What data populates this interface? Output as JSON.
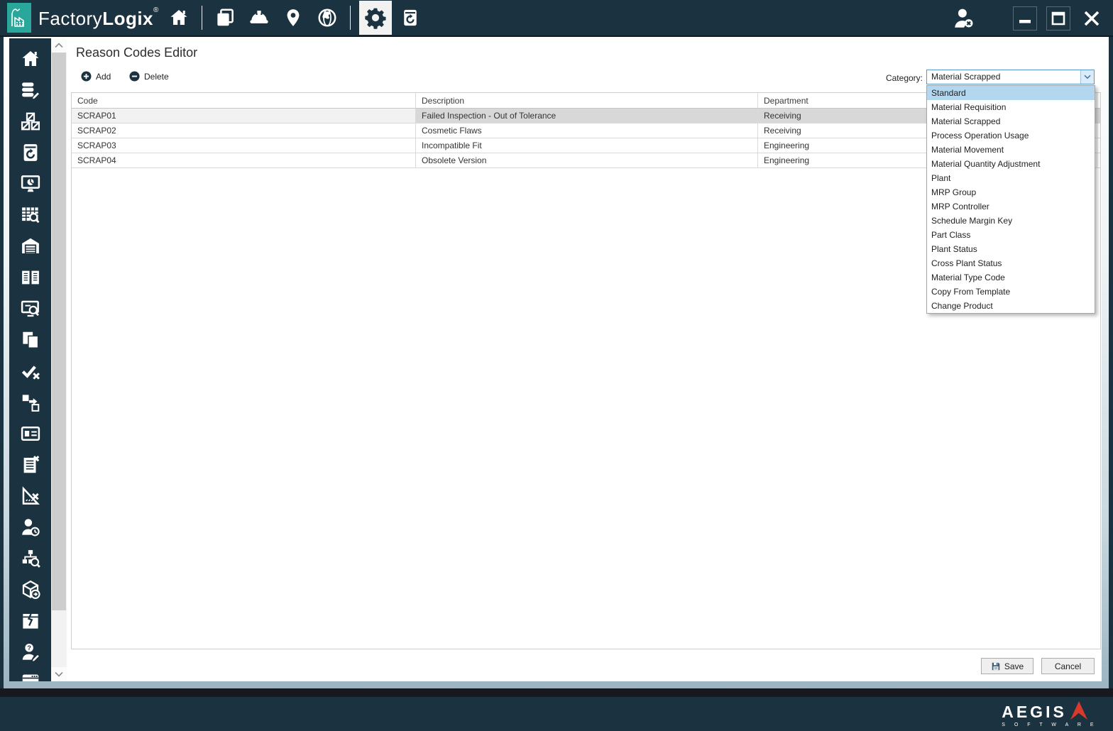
{
  "titlebar": {
    "brand": {
      "part1": "Factory",
      "part2": "Logix",
      "mark": "®"
    },
    "nav_icons": [
      "home",
      "pages",
      "hardhat",
      "location-pin",
      "globe",
      "settings-gear",
      "restore-backup"
    ],
    "active_icon": "settings-gear",
    "window_controls": [
      "user-signout",
      "minimize",
      "maximize",
      "close"
    ]
  },
  "sidebar": {
    "items": [
      "home",
      "data-editor",
      "materials",
      "backup",
      "dashboard",
      "data-grid-search",
      "warehouse",
      "documentation",
      "monitor-search",
      "documents",
      "approve-reject",
      "transfer",
      "id-card",
      "list-delete",
      "measure-delete",
      "user-time",
      "org-search",
      "package-export",
      "damaged-package",
      "user-query",
      "terminal"
    ]
  },
  "editor": {
    "title": "Reason Codes Editor",
    "toolbar": {
      "add_label": "Add",
      "delete_label": "Delete"
    },
    "category": {
      "label": "Category:",
      "value": "Material Scrapped",
      "highlighted_index": 0,
      "options": [
        "Standard",
        "Material Requisition",
        "Material Scrapped",
        "Process Operation Usage",
        "Material Movement",
        "Material Quantity Adjustment",
        "Plant",
        "MRP Group",
        "MRP Controller",
        "Schedule Margin Key",
        "Part Class",
        "Plant Status",
        "Cross Plant Status",
        "Material Type Code",
        "Copy From Template",
        "Change Product"
      ]
    },
    "table": {
      "columns": [
        "Code",
        "Description",
        "Department"
      ],
      "rows": [
        {
          "code": "SCRAP01",
          "description": "Failed Inspection - Out of Tolerance",
          "department": "Receiving",
          "selected": true
        },
        {
          "code": "SCRAP02",
          "description": "Cosmetic Flaws",
          "department": "Receiving",
          "selected": false
        },
        {
          "code": "SCRAP03",
          "description": "Incompatible Fit",
          "department": "Engineering",
          "selected": false
        },
        {
          "code": "SCRAP04",
          "description": "Obsolete Version",
          "department": "Engineering",
          "selected": false
        }
      ]
    },
    "buttons": {
      "save": "Save",
      "cancel": "Cancel"
    }
  },
  "footer": {
    "logo_primary": "AEGIS",
    "logo_secondary": "S O F T W A R E"
  },
  "colors": {
    "navy": "#1b3240",
    "teal_accent": "#2aa79b",
    "selection_gray": "#d8d8d8",
    "dropdown_highlight": "#b3d7ef",
    "combo_border": "#5796d2",
    "logo_red": "#d93a2b"
  }
}
